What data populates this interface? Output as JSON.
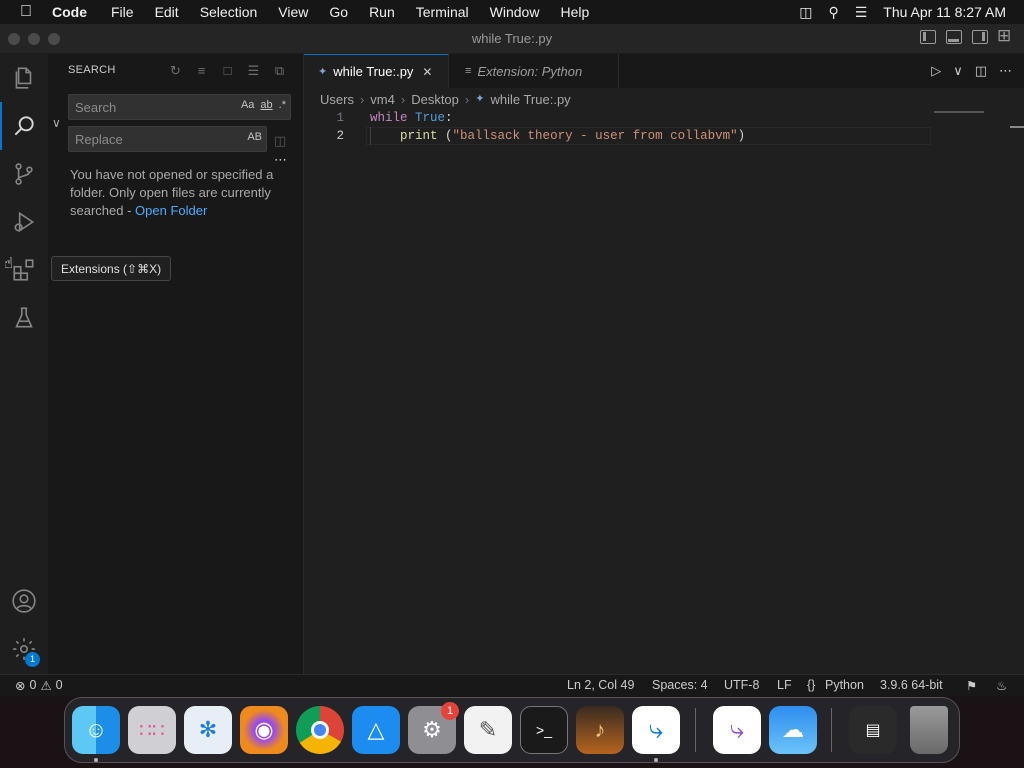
{
  "menubar": {
    "app": "Code",
    "items": [
      "File",
      "Edit",
      "Selection",
      "View",
      "Go",
      "Run",
      "Terminal",
      "Window",
      "Help"
    ],
    "clock": "Thu Apr 11  8:27 AM"
  },
  "window": {
    "title": "while True:.py"
  },
  "sidebar": {
    "header": "SEARCH",
    "search_placeholder": "Search",
    "replace_placeholder": "Replace",
    "search_opts": [
      "Aa",
      "ab",
      ".*"
    ],
    "replace_opts": "AB",
    "message": "You have not opened or specified a folder. Only open files are currently searched - ",
    "open_folder_link": "Open Folder"
  },
  "tooltip": "Extensions (⇧⌘X)",
  "tabs": [
    {
      "label": "while True:.py",
      "active": true
    },
    {
      "label": "Extension: Python",
      "active": false
    }
  ],
  "breadcrumb": [
    "Users",
    "vm4",
    "Desktop",
    "while True:.py"
  ],
  "code": {
    "line1": {
      "num": "1",
      "kw": "while",
      "const": "True",
      "rest": ":"
    },
    "line2": {
      "num": "2",
      "fn": "print",
      "open": " (",
      "str": "\"ballsack theory - user from collabvm\"",
      "close": ")"
    }
  },
  "statusbar": {
    "errors": "0",
    "warnings": "0",
    "position": "Ln 2, Col 49",
    "spaces": "Spaces: 4",
    "encoding": "UTF-8",
    "eol": "LF",
    "language": "Python",
    "interpreter": "3.9.6 64-bit"
  },
  "activity": {
    "settings_badge": "1"
  },
  "dock": {
    "settings_badge": "1"
  },
  "icons": {
    "apple": "apple-logo",
    "explorer": "files-icon",
    "search": "search-icon",
    "scm": "source-control-icon",
    "debug": "run-debug-icon",
    "extensions": "extensions-icon",
    "testing": "beaker-icon",
    "accounts": "account-icon",
    "manage": "gear-icon"
  }
}
